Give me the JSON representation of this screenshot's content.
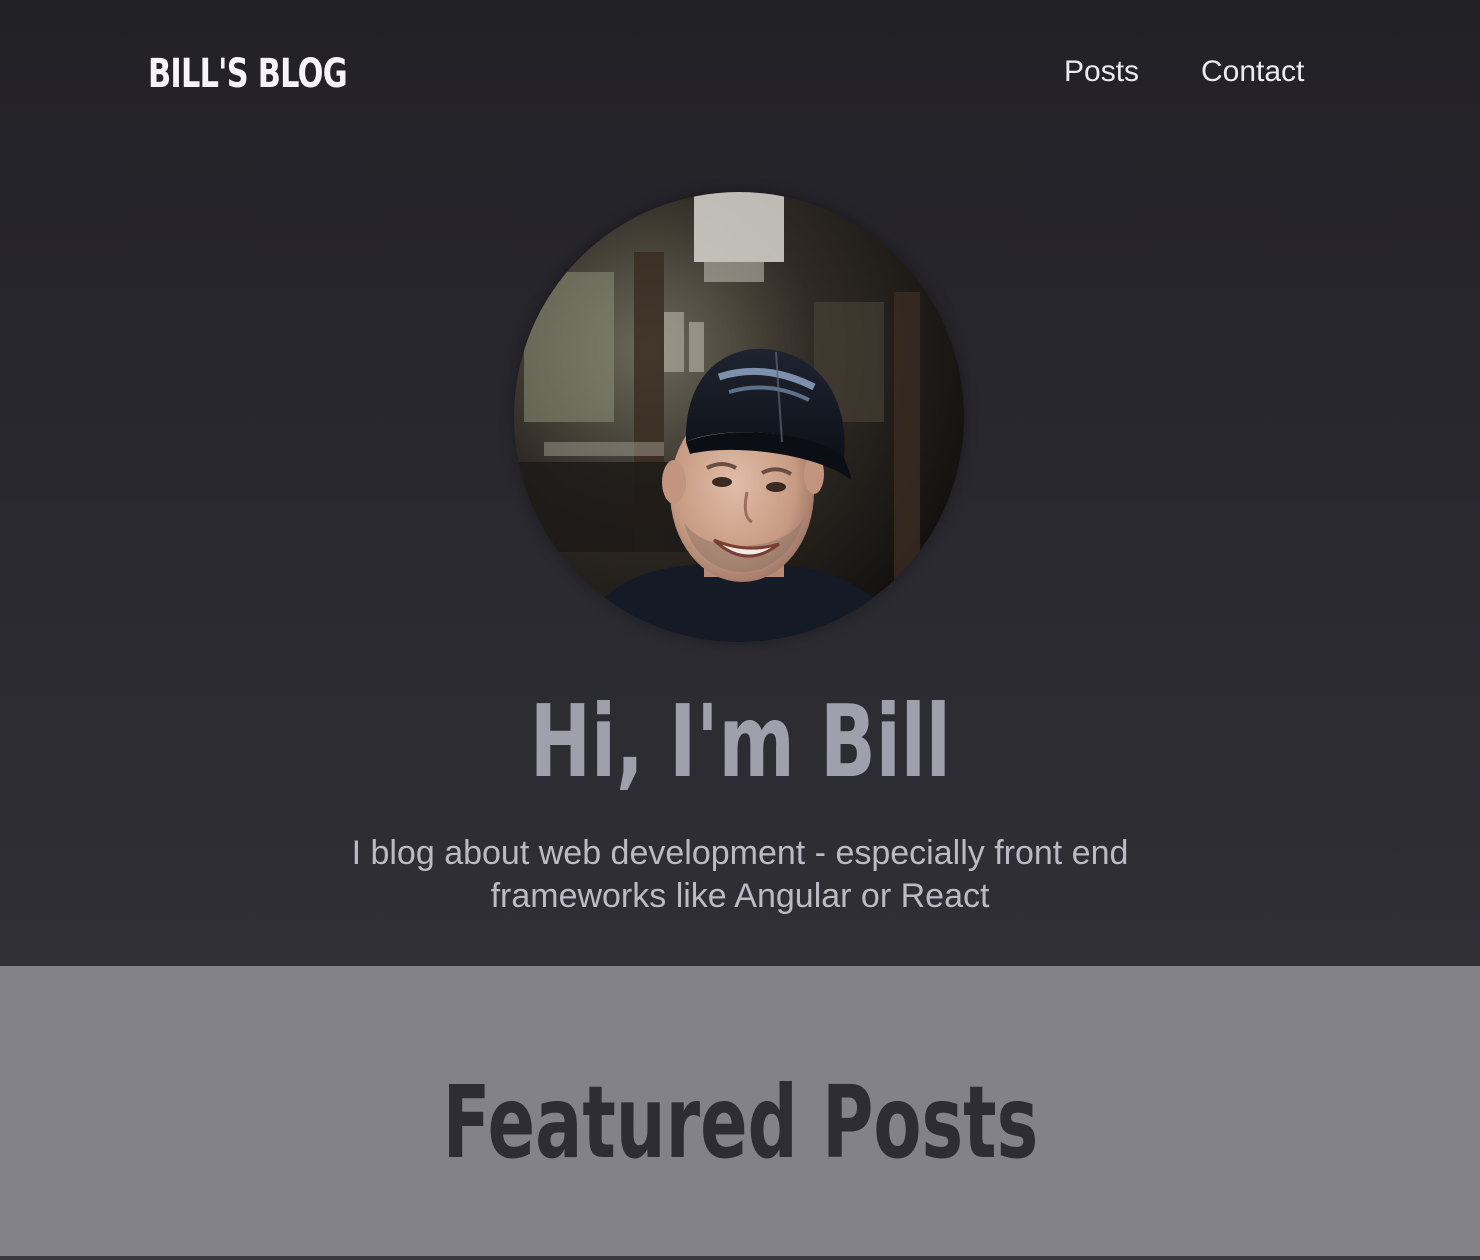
{
  "header": {
    "brand": "BILL'S BLOG",
    "nav": [
      "Posts",
      "Contact"
    ]
  },
  "hero": {
    "title": "Hi, I'm Bill",
    "subtitle": "I blog about web development - especially front end frameworks like Angular or React"
  },
  "featured": {
    "title": "Featured Posts"
  },
  "colors": {
    "hero_bg": "#2b2a30",
    "brand": "#f6f4fa",
    "hero_title": "#a09fac",
    "featured_bg": "#838288",
    "featured_title": "#2e2d33"
  }
}
